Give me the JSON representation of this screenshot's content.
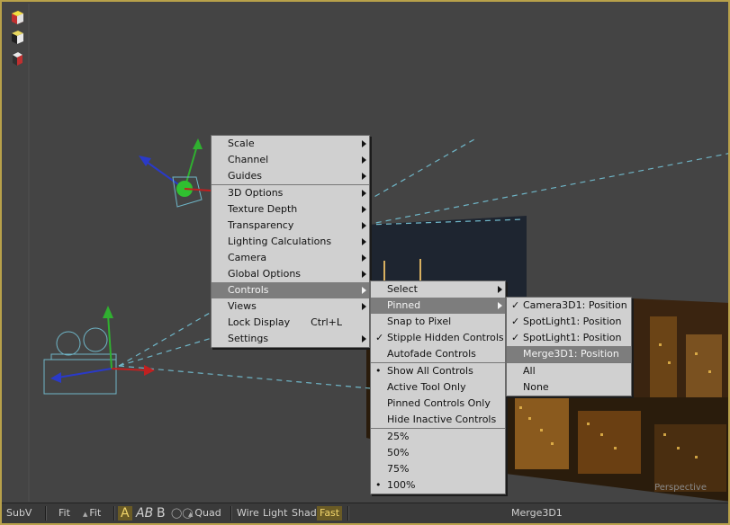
{
  "viewport": {
    "label": "Perspective",
    "icons": [
      "cube-red-icon",
      "cube-white-icon",
      "cube-small-icon"
    ]
  },
  "main_menu": [
    {
      "label": "Scale",
      "submenu": true
    },
    {
      "label": "Channel",
      "submenu": true
    },
    {
      "label": "Guides",
      "submenu": true
    },
    {
      "separator": true
    },
    {
      "label": "3D Options",
      "submenu": true
    },
    {
      "label": "Texture Depth",
      "submenu": true
    },
    {
      "label": "Transparency",
      "submenu": true
    },
    {
      "label": "Lighting Calculations",
      "submenu": true
    },
    {
      "label": "Camera",
      "submenu": true
    },
    {
      "label": "Global Options",
      "submenu": true
    },
    {
      "label": "Controls",
      "submenu": true,
      "selected": true
    },
    {
      "label": "Views",
      "submenu": true
    },
    {
      "label": "Lock Display",
      "shortcut": "Ctrl+L"
    },
    {
      "label": "Settings",
      "submenu": true
    }
  ],
  "controls_menu": [
    {
      "label": "Select",
      "submenu": true
    },
    {
      "label": "Pinned",
      "submenu": true,
      "selected": true
    },
    {
      "label": "Snap to Pixel"
    },
    {
      "label": "Stipple Hidden Controls",
      "mark": "✓"
    },
    {
      "label": "Autofade Controls"
    },
    {
      "separator": true
    },
    {
      "label": "Show All Controls",
      "mark": "•"
    },
    {
      "label": "Active Tool Only"
    },
    {
      "label": "Pinned Controls Only"
    },
    {
      "label": "Hide Inactive Controls"
    },
    {
      "separator": true
    },
    {
      "label": "25%"
    },
    {
      "label": "50%"
    },
    {
      "label": "75%"
    },
    {
      "label": "100%",
      "mark": "•"
    }
  ],
  "pinned_menu": [
    {
      "label": "Camera3D1: Position",
      "mark": "✓"
    },
    {
      "label": "SpotLight1: Position",
      "mark": "✓"
    },
    {
      "label": "SpotLight1: Position",
      "mark": "✓"
    },
    {
      "label": "Merge3D1: Position",
      "selected": true
    },
    {
      "separator": true
    },
    {
      "label": "All"
    },
    {
      "label": "None"
    }
  ],
  "toolbar": {
    "subv": "SubV",
    "fit": "Fit",
    "fit2": "Fit",
    "a": "A",
    "ab": "AB",
    "b": "B",
    "quad": "Quad",
    "wire": "Wire",
    "light": "Light",
    "shad": "Shad",
    "fast": "Fast",
    "node_name": "Merge3D1"
  },
  "colors": {
    "accent": "#b8a14a",
    "menu_bg": "#d0d0d0",
    "menu_highlight": "#7d7d7d",
    "viewport_bg": "#444444"
  }
}
